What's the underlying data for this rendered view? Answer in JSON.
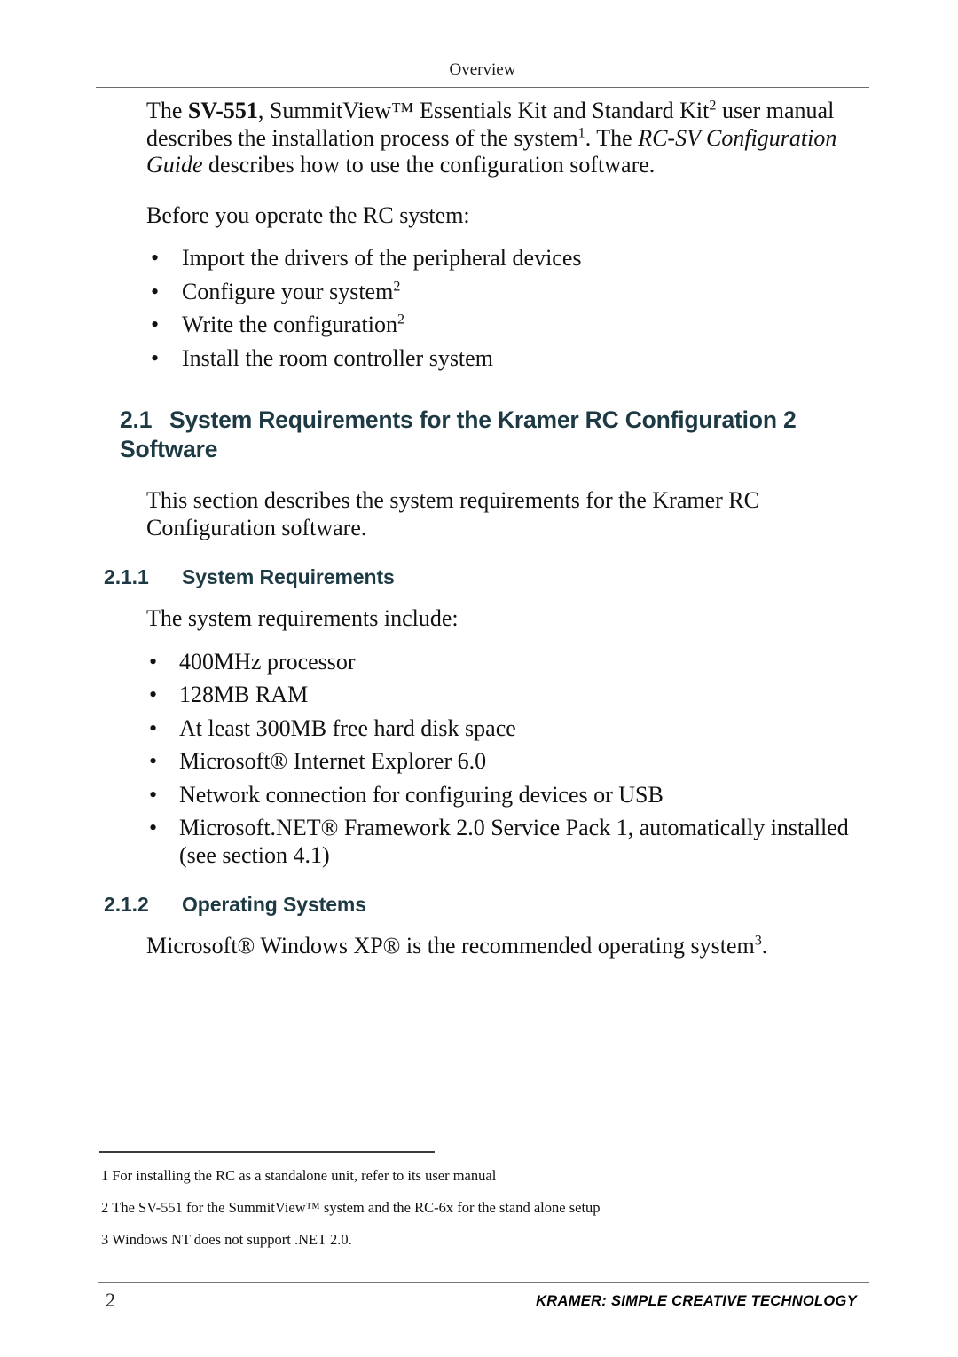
{
  "page": {
    "running_header": "Overview",
    "page_number": "2",
    "brand_footer": "KRAMER:  SIMPLE CREATIVE TECHNOLOGY",
    "heading_color": "#1d3a44",
    "rule_color": "#6b6b6b"
  },
  "intro": {
    "para1_seg1": "The ",
    "para1_bold": "SV-551",
    "para1_seg2": ", SummitView™ Essentials Kit and Standard Kit",
    "para1_sup1": "2",
    "para1_seg3": " user manual describes the installation process of the system",
    "para1_sup2": "1",
    "para1_seg4": ". The ",
    "para1_italic1": "RC-SV Configuration Guide",
    "para1_seg5": " describes how to use the configuration software.",
    "para2": "Before you operate the RC system:"
  },
  "intro_bullets": [
    {
      "text": "Import the drivers of the peripheral devices",
      "sup": ""
    },
    {
      "text": "Configure your system",
      "sup": "2"
    },
    {
      "text": "Write the configuration",
      "sup": "2"
    },
    {
      "text": "Install the room controller system",
      "sup": ""
    }
  ],
  "section": {
    "number": "2.1",
    "title": "System Requirements for the Kramer RC Configuration 2 Software",
    "intro_para": "This section describes the system requirements for the Kramer RC Configuration software."
  },
  "subsection_1": {
    "number": "2.1.1",
    "title": "System Requirements",
    "lead_para": "The system requirements include:",
    "bullets": [
      "400MHz processor",
      "128MB RAM",
      "At least 300MB free hard disk space",
      "Microsoft®  Internet Explorer 6.0",
      "Network connection for configuring devices or USB",
      "Microsoft.NET® Framework 2.0 Service Pack 1, automatically installed (see section 4.1)"
    ]
  },
  "subsection_2": {
    "number": "2.1.2",
    "title": "Operating Systems",
    "para_seg1": "Microsoft® Windows XP® is the recommended operating system",
    "para_sup": "3",
    "para_seg2": "."
  },
  "footnotes": [
    {
      "num": "1",
      "text": "For installing the RC as a standalone unit, refer to its user manual"
    },
    {
      "num": "2",
      "text": "The SV-551 for the SummitView™ system and the RC-6x for the stand alone setup"
    },
    {
      "num": "3",
      "text": "Windows NT does not support .NET 2.0."
    }
  ]
}
